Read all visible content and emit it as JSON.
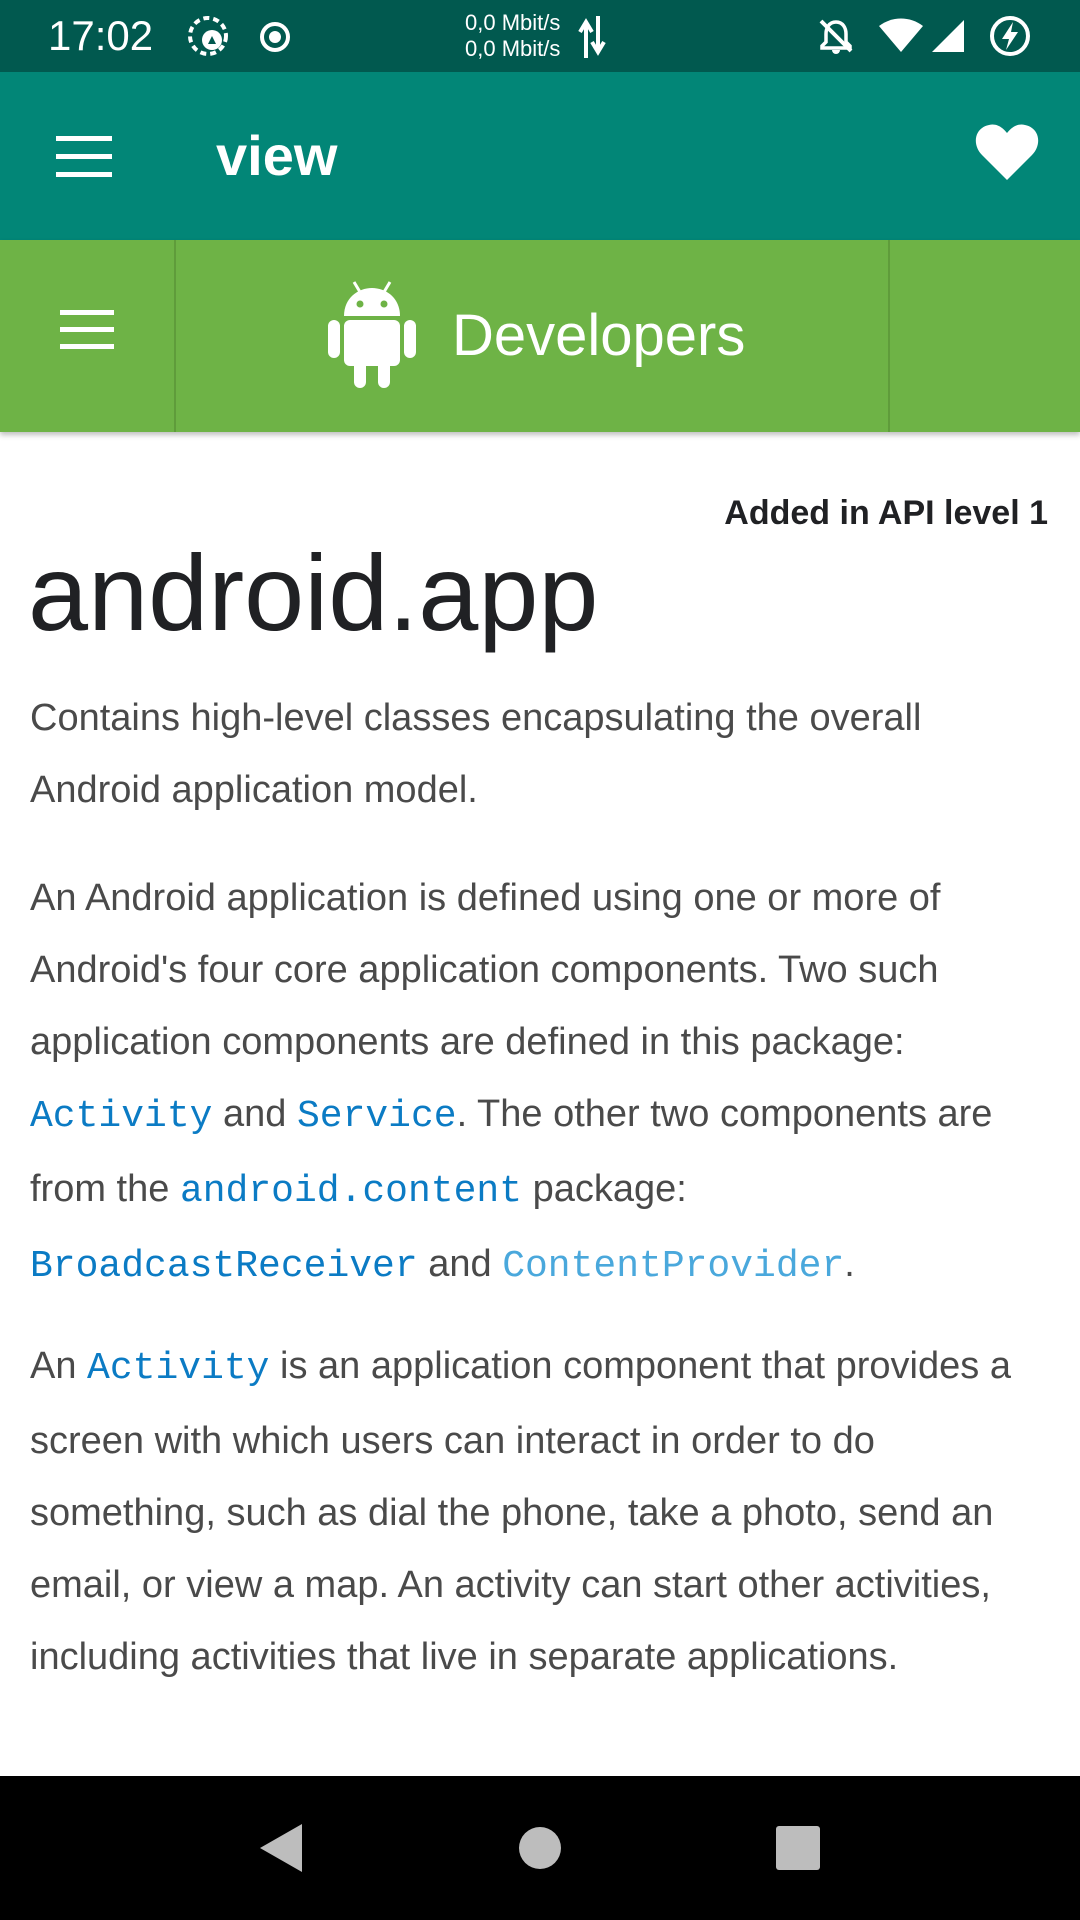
{
  "status_bar": {
    "time": "17:02",
    "net_speed_up": "0,0 Mbit/s",
    "net_speed_down": "0,0 Mbit/s",
    "icons": [
      "data-saver-icon",
      "record-icon",
      "transfer-arrows-icon",
      "notifications-off-icon",
      "wifi-icon",
      "signal-icon",
      "battery-charging-icon"
    ]
  },
  "app_bar": {
    "title": "view",
    "menu_icon": "hamburger-menu-icon",
    "favorite_icon": "heart-icon"
  },
  "dev_header": {
    "title": "Developers",
    "menu_icon": "hamburger-menu-icon",
    "logo_icon": "android-robot-icon"
  },
  "content": {
    "api_level": "Added in API level 1",
    "title": "android.app",
    "para1": "Contains high-level classes encapsulating the overall Android application model.",
    "para2": {
      "text_a": "An Android application is defined using one or more of Android's four core application components. Two such application components are defined in this package: ",
      "link_activity": "Activity",
      "text_and1": " and ",
      "link_service": "Service",
      "text_b": ". The other two components are from the ",
      "link_content": "android.content",
      "text_c": " package: ",
      "link_receiver": "BroadcastReceiver",
      "text_and2": " and ",
      "link_provider": "ContentProvider",
      "text_end": "."
    },
    "para3": {
      "text_a": "An ",
      "link_activity": "Activity",
      "text_b": " is an application component that provides a screen with which users can interact in order to do something, such as dial the phone, take a photo, send an email, or view a map. An activity can start other activities, including activities that live in separate applications."
    }
  },
  "nav_bar": {
    "back_icon": "back-triangle-icon",
    "home_icon": "home-circle-icon",
    "recents_icon": "recents-square-icon"
  },
  "colors": {
    "status_bar": "#01594f",
    "app_bar": "#028677",
    "dev_header": "#6eb346",
    "link": "#0b7bc4"
  }
}
